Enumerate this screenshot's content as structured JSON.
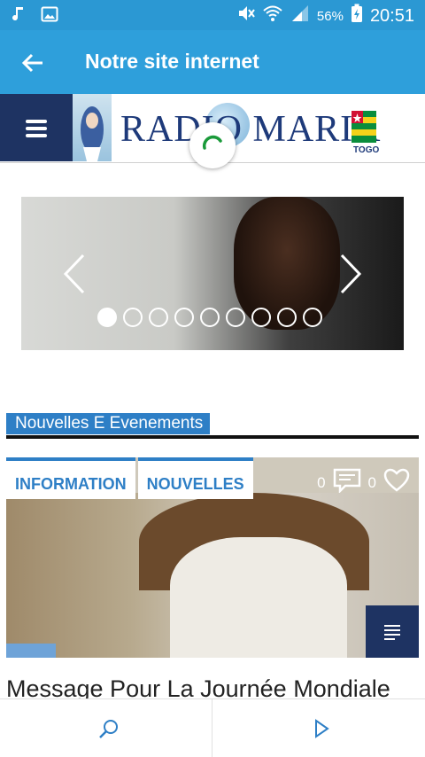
{
  "status_bar": {
    "icons_left": [
      "music-note-icon",
      "image-icon"
    ],
    "icons_right": [
      "mute-icon",
      "wifi-icon",
      "signal-icon"
    ],
    "battery_percent": "56%",
    "time": "20:51"
  },
  "app_bar": {
    "title": "Notre site internet"
  },
  "site_header": {
    "logo_text": "RADIO MARIA",
    "country": "TOGO"
  },
  "slider": {
    "slide_count": 9,
    "active_index": 0
  },
  "section": {
    "title": "Nouvelles E Evenements"
  },
  "article": {
    "tags": [
      "INFORMATION",
      "NOUVELLES"
    ],
    "comments": "0",
    "likes": "0",
    "headline": "Message Pour La Journée Mondiale"
  },
  "colors": {
    "status_bar": "#2b98d3",
    "app_bar": "#2e9fdb",
    "accent": "#2e7fc6",
    "navy": "#1e3362"
  }
}
